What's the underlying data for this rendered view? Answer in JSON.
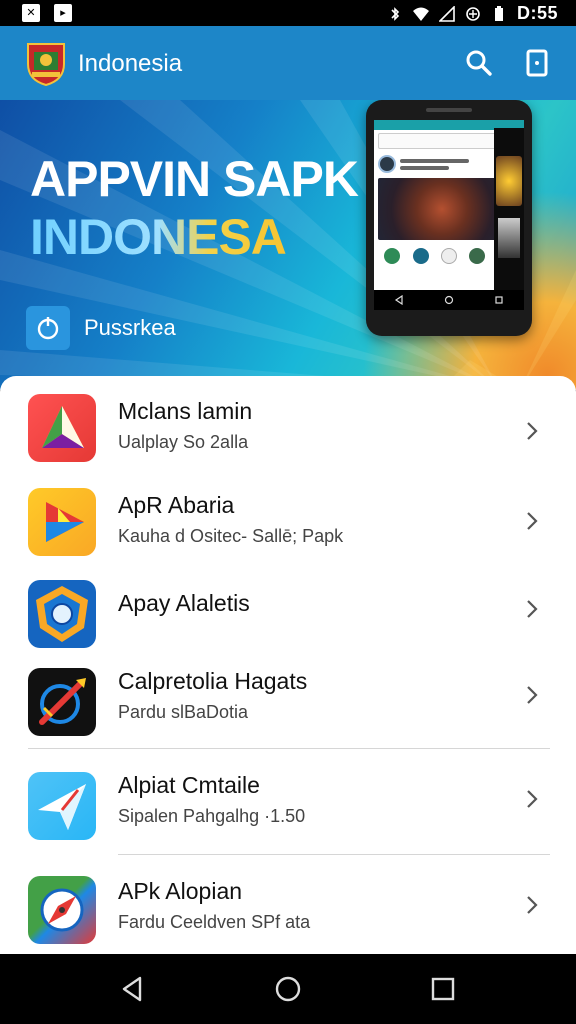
{
  "status_bar": {
    "time": "D:55",
    "notif_icons": [
      "notification-icon",
      "notification-icon"
    ],
    "icons": [
      "bluetooth-icon",
      "wifi-icon",
      "no-signal-icon",
      "data-saver-icon",
      "battery-icon"
    ]
  },
  "app_bar": {
    "title": "Indonesia",
    "logo": "coat-of-arms-logo",
    "actions": [
      "search-icon",
      "menu-icon"
    ]
  },
  "hero": {
    "title_line1": "APPVIN SAPK",
    "title_line2": "INDONESA",
    "action_label": "Pussrkea",
    "action_icon": "drop-icon",
    "colors": {
      "blue": "#1580c8",
      "cyan": "#2cc4c8",
      "orange": "#f08a2a",
      "yellow": "#f7c431"
    }
  },
  "list": {
    "items": [
      {
        "title": "Mclans lamin",
        "subtitle": "Ualplay So 2alla",
        "icon": "colorful-triangle-icon"
      },
      {
        "title": "ApR Abaria",
        "subtitle": "Kauha d Ositec- Sallē; Papk",
        "icon": "play-arrow-icon"
      },
      {
        "title": "Apay Alaletis",
        "subtitle": "",
        "icon": "shield-badge-icon"
      },
      {
        "title": "Calpretolia Hagats",
        "subtitle": "Pardu slBaDotia",
        "icon": "rocket-icon"
      },
      {
        "title": "Alpiat Cmtaile",
        "subtitle": "Sipalen Pahgalhg ·1.50",
        "icon": "paper-plane-icon"
      },
      {
        "title": "APk Alopian",
        "subtitle": "Fardu Ceeldven SPf ata",
        "icon": "compass-icon"
      }
    ]
  },
  "nav_bar": {
    "buttons": [
      "back-icon",
      "home-icon",
      "recents-icon"
    ]
  }
}
